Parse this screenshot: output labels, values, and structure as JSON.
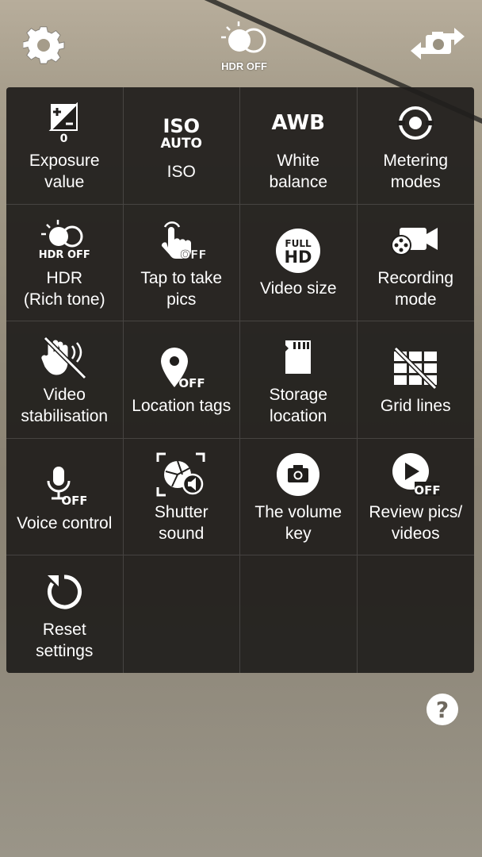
{
  "top_bar": {
    "hdr_label": "HDR OFF"
  },
  "icons": {
    "settings": "gear-icon",
    "hdr": "hdr-icon",
    "switch_camera": "switch-camera-icon",
    "help": "help-icon"
  },
  "colors": {
    "panel_background": "#201e1c",
    "text": "#ffffff"
  },
  "grid": {
    "exposure_value": {
      "label": "Exposure\nvalue",
      "icon_value": "0",
      "icon": "exposure-icon"
    },
    "iso": {
      "label": "ISO",
      "icon_top": "ISO",
      "icon_bottom": "AUTO",
      "icon": "iso-icon"
    },
    "white_balance": {
      "label": "White\nbalance",
      "icon_text": "AWB",
      "icon": "white-balance-icon"
    },
    "metering_modes": {
      "label": "Metering\nmodes",
      "icon": "metering-icon"
    },
    "hdr": {
      "label": "HDR\n(Rich tone)",
      "icon_text": "HDR OFF",
      "icon": "hdr-icon"
    },
    "tap_to_take": {
      "label": "Tap to take\npics",
      "icon_text": "OFF",
      "icon": "tap-icon"
    },
    "video_size": {
      "label": "Video size",
      "icon_top": "FULL",
      "icon_bottom": "HD",
      "icon": "full-hd-icon"
    },
    "recording_mode": {
      "label": "Recording\nmode",
      "icon": "video-camera-icon"
    },
    "video_stabilisation": {
      "label": "Video\nstabilisation",
      "icon": "stabilisation-off-icon"
    },
    "location_tags": {
      "label": "Location tags",
      "icon_text": "OFF",
      "icon": "location-pin-icon"
    },
    "storage_location": {
      "label": "Storage\nlocation",
      "icon": "sd-card-icon"
    },
    "grid_lines": {
      "label": "Grid lines",
      "icon": "grid-off-icon"
    },
    "voice_control": {
      "label": "Voice control",
      "icon_text": "OFF",
      "icon": "microphone-icon"
    },
    "shutter_sound": {
      "label": "Shutter\nsound",
      "icon": "shutter-sound-icon"
    },
    "volume_key": {
      "label": "The volume\nkey",
      "icon": "camera-icon"
    },
    "review_pics": {
      "label": "Review pics/\nvideos",
      "icon_text": "OFF",
      "icon": "play-icon"
    },
    "reset_settings": {
      "label": "Reset\nsettings",
      "icon": "reset-icon"
    }
  }
}
